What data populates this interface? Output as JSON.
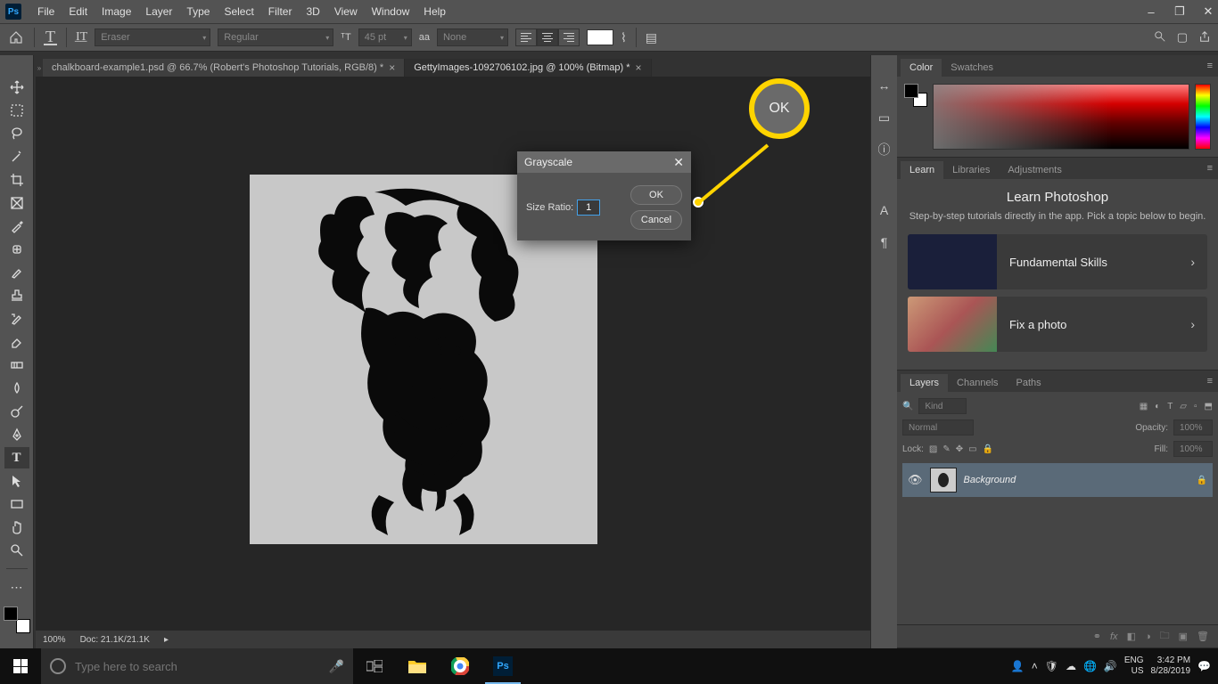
{
  "menubar": {
    "items": [
      "File",
      "Edit",
      "Image",
      "Layer",
      "Type",
      "Select",
      "Filter",
      "3D",
      "View",
      "Window",
      "Help"
    ]
  },
  "optbar": {
    "brush_preset": "Eraser",
    "style_preset": "Regular",
    "size": "45 pt",
    "aa": "aa",
    "anti_alias": "None"
  },
  "tabs": {
    "inactive": "chalkboard-example1.psd @ 66.7% (Robert's Photoshop Tutorials, RGB/8) *",
    "active": "GettyImages-1092706102.jpg @ 100% (Bitmap) *"
  },
  "status": {
    "zoom": "100%",
    "docinfo": "Doc: 21.1K/21.1K"
  },
  "color_panel": {
    "tabs": [
      "Color",
      "Swatches"
    ]
  },
  "learn": {
    "tabs": [
      "Learn",
      "Libraries",
      "Adjustments"
    ],
    "title": "Learn Photoshop",
    "sub": "Step-by-step tutorials directly in the app. Pick a topic below to begin.",
    "card1": "Fundamental Skills",
    "card2": "Fix a photo"
  },
  "layers": {
    "tabs": [
      "Layers",
      "Channels",
      "Paths"
    ],
    "filter_placeholder": "Kind",
    "blend": "Normal",
    "opacity_label": "Opacity:",
    "opacity_val": "100%",
    "lock_label": "Lock:",
    "fill_label": "Fill:",
    "fill_val": "100%",
    "layer1": "Background"
  },
  "dialog": {
    "title": "Grayscale",
    "ratio_label": "Size Ratio:",
    "ratio_value": "1",
    "ok": "OK",
    "cancel": "Cancel"
  },
  "callout": {
    "ok": "OK"
  },
  "taskbar": {
    "search_placeholder": "Type here to search",
    "lang": "ENG",
    "region": "US",
    "time": "3:42 PM",
    "date": "8/28/2019"
  }
}
